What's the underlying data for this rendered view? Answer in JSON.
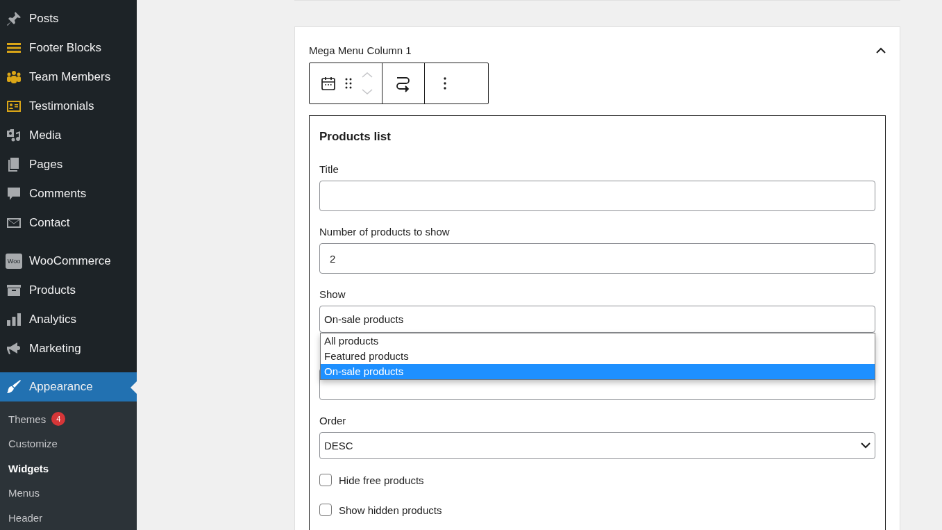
{
  "sidebar": {
    "menu_groups": [
      [
        {
          "label": "Posts",
          "selected": false
        },
        {
          "label": "Footer Blocks",
          "selected": false
        },
        {
          "label": "Team Members",
          "selected": false
        },
        {
          "label": "Testimonials",
          "selected": false
        },
        {
          "label": "Media",
          "selected": false
        },
        {
          "label": "Pages",
          "selected": false
        },
        {
          "label": "Comments",
          "selected": false
        },
        {
          "label": "Contact",
          "selected": false
        }
      ],
      [
        {
          "label": "WooCommerce",
          "selected": false,
          "icon_text": "Woo"
        },
        {
          "label": "Products",
          "selected": false
        },
        {
          "label": "Analytics",
          "selected": false
        },
        {
          "label": "Marketing",
          "selected": false
        }
      ],
      [
        {
          "label": "Appearance",
          "selected": true
        }
      ]
    ],
    "submenu": [
      {
        "label": "Themes",
        "badge": "4",
        "selected": false
      },
      {
        "label": "Customize",
        "selected": false
      },
      {
        "label": "Widgets",
        "selected": true
      },
      {
        "label": "Menus",
        "selected": false
      },
      {
        "label": "Header",
        "selected": false
      }
    ]
  },
  "widget": {
    "title": "Mega Menu Column 1",
    "expanded": true,
    "block": {
      "title": "Products list",
      "fields": [
        {
          "kind": "text",
          "label": "Title"
        },
        {
          "kind": "text",
          "label": "Number of products to show",
          "value": "2"
        },
        {
          "kind": "select",
          "label": "Show",
          "value": "On-sale products",
          "open": true,
          "options": [
            {
              "label": "All products",
              "selected": false
            },
            {
              "label": "Featured products",
              "selected": false
            },
            {
              "label": "On-sale products",
              "selected": true
            }
          ]
        },
        {
          "kind": "covered-select"
        },
        {
          "kind": "select",
          "label": "Order",
          "value": "DESC",
          "open": false
        },
        {
          "kind": "checkbox",
          "label": "Hide free products",
          "checked": false
        },
        {
          "kind": "checkbox",
          "label": "Show hidden products",
          "checked": false
        }
      ]
    }
  }
}
